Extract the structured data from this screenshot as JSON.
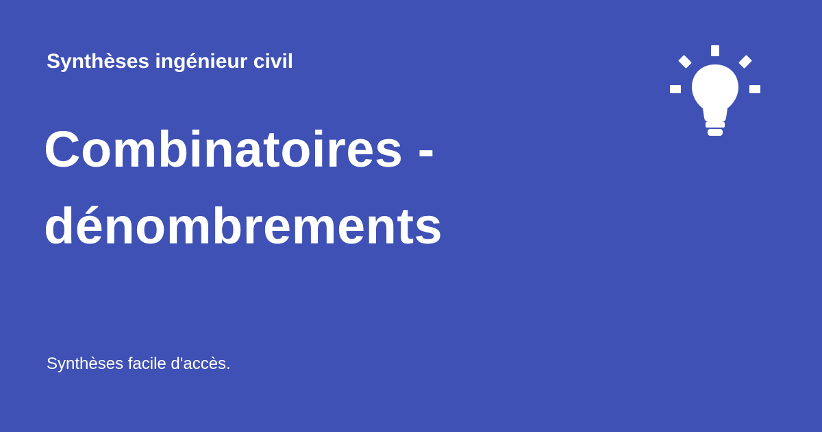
{
  "header": {
    "site_name": "Synthèses ingénieur civil"
  },
  "main": {
    "title": "Combinatoires - dénombrements"
  },
  "footer": {
    "tagline": "Synthèses facile d'accès."
  },
  "decoration": {
    "icon": "lightbulb-icon"
  },
  "colors": {
    "background": "#3f51b5",
    "text": "#ffffff"
  }
}
